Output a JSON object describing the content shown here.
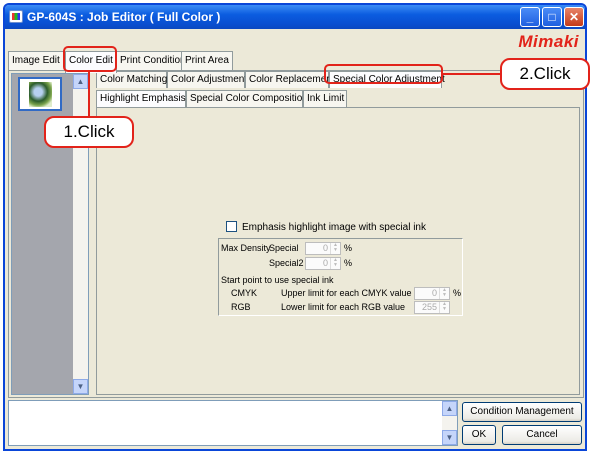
{
  "window": {
    "title": "GP-604S : Job Editor ( Full Color )",
    "logo": "Mimaki",
    "controls": {
      "minimize": "_",
      "maximize": "□",
      "close": "✕"
    }
  },
  "main_tabs": [
    {
      "label": "Image Edit",
      "active": false
    },
    {
      "label": "Color Edit",
      "active": true
    },
    {
      "label": "Print Condition",
      "active": false
    },
    {
      "label": "Print Area",
      "active": false
    }
  ],
  "sub_tabs_row1": [
    {
      "label": "Color Matching",
      "active": false
    },
    {
      "label": "Color Adjustment",
      "active": false
    },
    {
      "label": "Color Replacement",
      "active": false
    },
    {
      "label": "Special Color Adjustment",
      "active": true
    }
  ],
  "sub_tabs_row2": [
    {
      "label": "Highlight Emphasis",
      "active": true
    },
    {
      "label": "Special Color Composition",
      "active": false
    },
    {
      "label": "Ink Limit",
      "active": false
    }
  ],
  "highlight": {
    "checkbox_label": "Emphasis highlight image with special ink",
    "max_density_label": "Max Density",
    "special_label": "Special",
    "special_value": "0",
    "special2_label": "Special2",
    "special2_value": "0",
    "percent": "%",
    "start_point_label": "Start point to use special ink",
    "cmyk_label": "CMYK",
    "cmyk_desc": "Upper limit for each CMYK value",
    "cmyk_value": "0",
    "rgb_label": "RGB",
    "rgb_desc": "Lower limit for each RGB value",
    "rgb_value": "255"
  },
  "buttons": {
    "condition_management": "Condition Management",
    "ok": "OK",
    "cancel": "Cancel"
  },
  "callouts": {
    "step1": "1.Click",
    "step2": "2.Click"
  },
  "colors": {
    "callout_border": "#e2231a",
    "titlebar": "#0a4fd0",
    "logo": "#e2231a"
  }
}
